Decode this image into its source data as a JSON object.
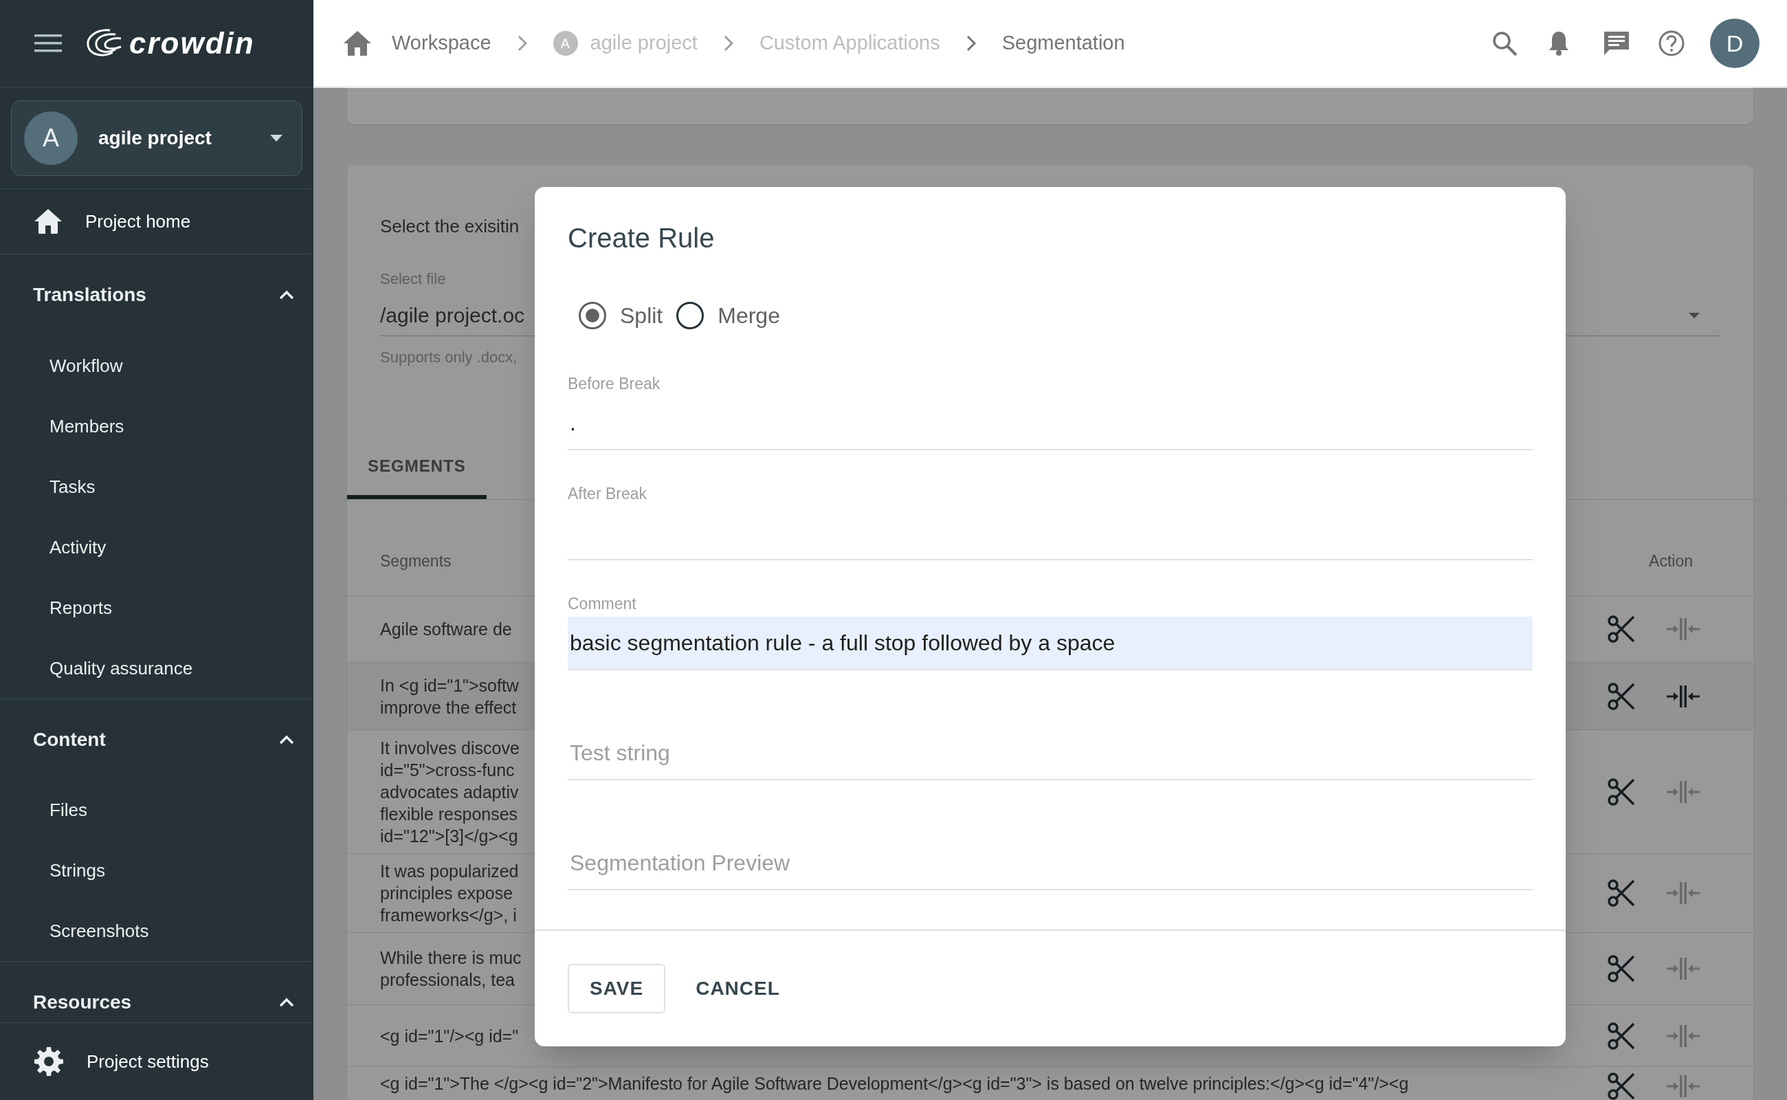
{
  "app": {
    "logo": "crowdin"
  },
  "project_selector": {
    "avatar": "A",
    "name": "agile project"
  },
  "sidebar": {
    "home": {
      "label": "Project home"
    },
    "sections": [
      {
        "title": "Translations",
        "expanded": true,
        "items": [
          "Workflow",
          "Members",
          "Tasks",
          "Activity",
          "Reports",
          "Quality assurance"
        ]
      },
      {
        "title": "Content",
        "expanded": true,
        "items": [
          "Files",
          "Strings",
          "Screenshots"
        ]
      },
      {
        "title": "Resources",
        "expanded": true
      }
    ],
    "settings": {
      "label": "Project settings"
    }
  },
  "breadcrumbs": [
    {
      "label": "Workspace",
      "muted": false
    },
    {
      "label": "agile project",
      "avatar": "A",
      "muted": true
    },
    {
      "label": "Custom Applications",
      "muted": true
    },
    {
      "label": "Segmentation",
      "muted": false
    }
  ],
  "user": {
    "avatar": "D"
  },
  "background": {
    "intro": "Select the exisitin",
    "file_label": "Select file",
    "file_value": "/agile project.oc",
    "file_hint": "Supports only .docx,",
    "tabs": [
      {
        "label": "SEGMENTS",
        "selected": true
      }
    ],
    "columns": [
      "Segments",
      "Action"
    ],
    "rows": [
      {
        "lines": [
          "Agile software de"
        ],
        "merge_enabled": false
      },
      {
        "lines": [
          "In <g id=\"1\">softw",
          "improve the effect"
        ],
        "merge_enabled": true
      },
      {
        "lines": [
          "It involves discove",
          "id=\"5\">cross-func",
          "advocates adaptiv",
          "flexible responses",
          "id=\"12\">[3]</g><g"
        ],
        "merge_enabled": false
      },
      {
        "lines": [
          "It was popularized",
          "principles expose",
          "frameworks</g>, i"
        ],
        "merge_enabled": false
      },
      {
        "lines": [
          "While there is muc",
          "professionals, tea"
        ],
        "merge_enabled": false
      },
      {
        "lines": [
          "<g id=\"1\"/><g id=\""
        ],
        "merge_enabled": false
      },
      {
        "lines": [
          "<g id=\"1\">The </g><g id=\"2\">Manifesto for Agile Software Development</g><g id=\"3\"> is based on twelve principles:</g><g id=\"4\"/><g"
        ],
        "merge_enabled": false
      }
    ]
  },
  "dialog": {
    "title": "Create Rule",
    "radios": [
      {
        "label": "Split",
        "selected": true
      },
      {
        "label": "Merge",
        "selected": false
      }
    ],
    "fields": [
      {
        "label": "Before Break",
        "value": ".",
        "highlighted": false
      },
      {
        "label": "After Break",
        "highlighted": false
      },
      {
        "label": "Comment",
        "value": "basic segmentation rule - a full stop followed by a space",
        "highlighted": true
      },
      {
        "placeholder": "Test string",
        "highlighted": false
      },
      {
        "placeholder": "Segmentation Preview",
        "highlighted": false
      }
    ],
    "buttons": [
      {
        "label": "SAVE",
        "kind": "outlined"
      },
      {
        "label": "CANCEL",
        "kind": "text"
      }
    ]
  }
}
